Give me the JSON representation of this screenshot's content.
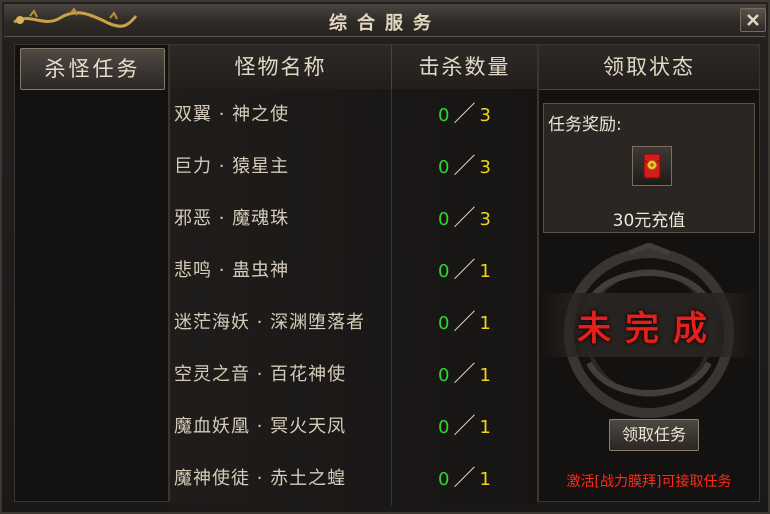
{
  "window": {
    "title": "综合服务"
  },
  "sidebar": {
    "tab_label": "杀怪任务"
  },
  "table": {
    "headers": [
      "怪物名称",
      "击杀数量",
      "领取状态"
    ],
    "rows": [
      {
        "name": "双翼 · 神之使",
        "current": "0",
        "sep": "／",
        "total": "3"
      },
      {
        "name": "巨力 · 猿星主",
        "current": "0",
        "sep": "／",
        "total": "3"
      },
      {
        "name": "邪恶 · 魔魂珠",
        "current": "0",
        "sep": "／",
        "total": "3"
      },
      {
        "name": "悲鸣 · 蛊虫神",
        "current": "0",
        "sep": "／",
        "total": "1"
      },
      {
        "name": "迷茫海妖 · 深渊堕落者",
        "current": "0",
        "sep": "／",
        "total": "1"
      },
      {
        "name": "空灵之音 · 百花神使",
        "current": "0",
        "sep": "／",
        "total": "1"
      },
      {
        "name": "魔血妖凰 · 冥火天凤",
        "current": "0",
        "sep": "／",
        "total": "1"
      },
      {
        "name": "魔神使徒 · 赤土之蝗",
        "current": "0",
        "sep": "／",
        "total": "1"
      }
    ]
  },
  "reward": {
    "label": "任务奖励:",
    "item_text": "30元充值",
    "item_icon": "red-envelope-icon"
  },
  "status": {
    "text": "未完成",
    "accept_button": "领取任务",
    "hint": "激活[战力膜拜]可接取任务"
  },
  "colors": {
    "progress_current": "#2bd62b",
    "progress_total": "#f0d418",
    "status_red": "#e3201a",
    "hint_red": "#ff2a1e"
  }
}
